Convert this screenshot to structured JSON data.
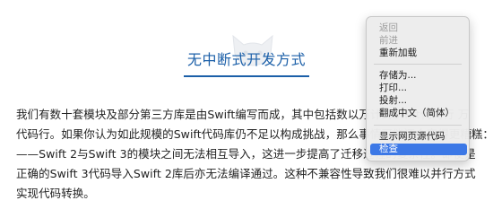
{
  "article": {
    "title": "无中断式开发方式",
    "paragraph_lines": [
      "我们有数十套模块及部分第三方库是由Swift编写而成，其中包括数以万计的Swift代码行 万",
      "代码行。如果你认为如此规模的Swift代码库仍不足以构成挑战，那么事情可能还会变得更糟糕：提醒",
      "——Swift 2与Swift 3的模块之间无法相互导入，这进一步提高了迁移过程的复杂性。即使是",
      "正确的Swift 3代码导入Swift 2库后亦无法编译通过。这种不兼容性导致我们很难以并行方式",
      "实现代码转换。"
    ],
    "logo_icon": "cat-head-watermark-icon"
  },
  "context_menu": {
    "items": [
      {
        "label": "返回",
        "enabled": false
      },
      {
        "label": "前进",
        "enabled": false
      },
      {
        "label": "重新加载",
        "enabled": true
      },
      {
        "label": "存储为...",
        "enabled": true
      },
      {
        "label": "打印...",
        "enabled": true
      },
      {
        "label": "投射...",
        "enabled": true
      },
      {
        "label": "翻成中文（简体）",
        "enabled": true
      },
      {
        "label": "显示网页源代码",
        "enabled": true
      },
      {
        "label": "检查",
        "enabled": true,
        "selected": true
      }
    ],
    "highlight_color": "#3c78e6"
  }
}
